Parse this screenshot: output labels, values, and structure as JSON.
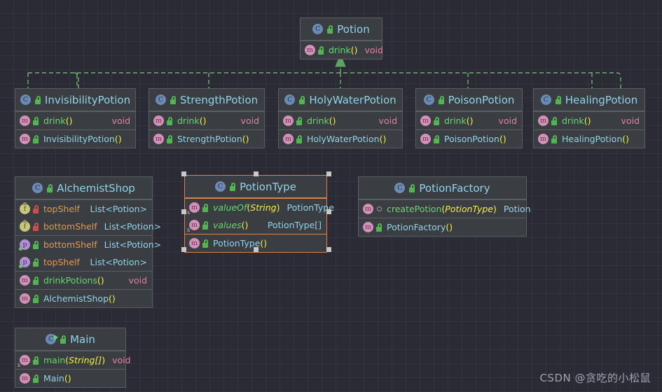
{
  "diagram": {
    "type": "uml-class-diagram",
    "background_color": "#2b2b35",
    "grid_color": "#3a3d46",
    "edge_color": "#6cb36c",
    "selection_color": "#d9834a",
    "title_color": "#8fd4e8",
    "method_color": "#62d96b",
    "field_color": "#e09a4b",
    "type_color": "#8fd4e8",
    "void_color": "#e87da8",
    "paren_color": "#f2f243"
  },
  "watermark": "CSDN @贪吃的小松鼠",
  "nodes": {
    "potion": {
      "name": "Potion",
      "icon": "class-icon",
      "visibility": "public",
      "selected": false,
      "members": [
        {
          "icon": "method-icon",
          "visibility": "public",
          "name": "drink",
          "args": "",
          "type": "void",
          "type_kind": "void",
          "kind": "method",
          "static": false
        }
      ]
    },
    "invisibility_potion": {
      "name": "InvisibilityPotion",
      "icon": "class-icon",
      "visibility": "public",
      "selected": false,
      "members": [
        {
          "icon": "method-icon",
          "visibility": "public",
          "name": "drink",
          "args": "",
          "type": "void",
          "type_kind": "void",
          "kind": "method",
          "static": false
        },
        {
          "icon": "method-icon",
          "visibility": "public",
          "name": "InvisibilityPotion",
          "args": "",
          "type": "",
          "type_kind": "none",
          "kind": "constructor",
          "static": false
        }
      ]
    },
    "strength_potion": {
      "name": "StrengthPotion",
      "icon": "class-icon",
      "visibility": "public",
      "selected": false,
      "members": [
        {
          "icon": "method-icon",
          "visibility": "public",
          "name": "drink",
          "args": "",
          "type": "void",
          "type_kind": "void",
          "kind": "method",
          "static": false
        },
        {
          "icon": "method-icon",
          "visibility": "public",
          "name": "StrengthPotion",
          "args": "",
          "type": "",
          "type_kind": "none",
          "kind": "constructor",
          "static": false
        }
      ]
    },
    "holy_water_potion": {
      "name": "HolyWaterPotion",
      "icon": "class-icon",
      "visibility": "public",
      "selected": false,
      "members": [
        {
          "icon": "method-icon",
          "visibility": "public",
          "name": "drink",
          "args": "",
          "type": "void",
          "type_kind": "void",
          "kind": "method",
          "static": false
        },
        {
          "icon": "method-icon",
          "visibility": "public",
          "name": "HolyWaterPotion",
          "args": "",
          "type": "",
          "type_kind": "none",
          "kind": "constructor",
          "static": false
        }
      ]
    },
    "poison_potion": {
      "name": "PoisonPotion",
      "icon": "class-icon",
      "visibility": "public",
      "selected": false,
      "members": [
        {
          "icon": "method-icon",
          "visibility": "public",
          "name": "drink",
          "args": "",
          "type": "void",
          "type_kind": "void",
          "kind": "method",
          "static": false
        },
        {
          "icon": "method-icon",
          "visibility": "public",
          "name": "PoisonPotion",
          "args": "",
          "type": "",
          "type_kind": "none",
          "kind": "constructor",
          "static": false
        }
      ]
    },
    "healing_potion": {
      "name": "HealingPotion",
      "icon": "class-icon",
      "visibility": "public",
      "selected": false,
      "members": [
        {
          "icon": "method-icon",
          "visibility": "public",
          "name": "drink",
          "args": "",
          "type": "void",
          "type_kind": "void",
          "kind": "method",
          "static": false
        },
        {
          "icon": "method-icon",
          "visibility": "public",
          "name": "HealingPotion",
          "args": "",
          "type": "",
          "type_kind": "none",
          "kind": "constructor",
          "static": false
        }
      ]
    },
    "alchemist_shop": {
      "name": "AlchemistShop",
      "icon": "class-icon",
      "visibility": "public",
      "selected": false,
      "sections": [
        [
          {
            "icon": "field-icon",
            "visibility": "private",
            "name": "topShelf",
            "args": null,
            "type": "List<Potion>",
            "type_kind": "type",
            "kind": "field",
            "static": false
          },
          {
            "icon": "field-icon",
            "visibility": "private",
            "name": "bottomShelf",
            "args": null,
            "type": "List<Potion>",
            "type_kind": "type",
            "kind": "field",
            "static": false
          }
        ],
        [
          {
            "icon": "property-icon",
            "visibility": "public",
            "name": "bottomShelf",
            "args": null,
            "type": "List<Potion>",
            "type_kind": "type",
            "kind": "property",
            "static": false
          },
          {
            "icon": "property-icon",
            "visibility": "public",
            "name": "topShelf",
            "args": null,
            "type": "List<Potion>",
            "type_kind": "type",
            "kind": "property",
            "static": false
          }
        ],
        [
          {
            "icon": "method-icon",
            "visibility": "public",
            "name": "drinkPotions",
            "args": "",
            "type": "void",
            "type_kind": "void",
            "kind": "method",
            "static": false
          }
        ],
        [
          {
            "icon": "method-icon",
            "visibility": "public",
            "name": "AlchemistShop",
            "args": "",
            "type": "",
            "type_kind": "none",
            "kind": "constructor",
            "static": false
          }
        ]
      ]
    },
    "potion_type": {
      "name": "PotionType",
      "icon": "class-icon",
      "visibility": "public",
      "selected": true,
      "sections": [
        [
          {
            "icon": "method-icon",
            "visibility": "public",
            "name": "valueOf",
            "args": "String",
            "args_italic": true,
            "type": "PotionType",
            "type_kind": "type",
            "kind": "method",
            "static": true
          },
          {
            "icon": "method-icon",
            "visibility": "public",
            "name": "values",
            "args": "",
            "type": "PotionType[]",
            "type_kind": "type",
            "kind": "method",
            "static": true
          }
        ],
        [
          {
            "icon": "method-icon",
            "visibility": "public",
            "name": "PotionType",
            "args": "",
            "type": "",
            "type_kind": "none",
            "kind": "constructor",
            "static": false
          }
        ]
      ]
    },
    "potion_factory": {
      "name": "PotionFactory",
      "icon": "class-icon",
      "visibility": "public",
      "selected": false,
      "sections": [
        [
          {
            "icon": "method-icon",
            "visibility": "package",
            "name": "createPotion",
            "args": "PotionType",
            "type": "Potion",
            "type_kind": "type",
            "kind": "method",
            "static": false
          }
        ],
        [
          {
            "icon": "method-icon",
            "visibility": "public",
            "name": "PotionFactory",
            "args": "",
            "type": "",
            "type_kind": "none",
            "kind": "constructor",
            "static": false
          }
        ]
      ]
    },
    "main": {
      "name": "Main",
      "icon": "class-runnable-icon",
      "visibility": "public",
      "selected": false,
      "sections": [
        [
          {
            "icon": "method-icon",
            "visibility": "public",
            "name": "main",
            "args": "String[]",
            "type": "void",
            "type_kind": "void",
            "kind": "method",
            "static": true,
            "static_marker": true
          }
        ],
        [
          {
            "icon": "method-icon",
            "visibility": "public",
            "name": "Main",
            "args": "",
            "type": "",
            "type_kind": "none",
            "kind": "constructor",
            "static": false
          }
        ]
      ]
    }
  },
  "relations": [
    {
      "from": "InvisibilityPotion",
      "to": "Potion",
      "type": "realization"
    },
    {
      "from": "StrengthPotion",
      "to": "Potion",
      "type": "realization"
    },
    {
      "from": "HolyWaterPotion",
      "to": "Potion",
      "type": "realization"
    },
    {
      "from": "PoisonPotion",
      "to": "Potion",
      "type": "realization"
    },
    {
      "from": "HealingPotion",
      "to": "Potion",
      "type": "realization"
    }
  ]
}
